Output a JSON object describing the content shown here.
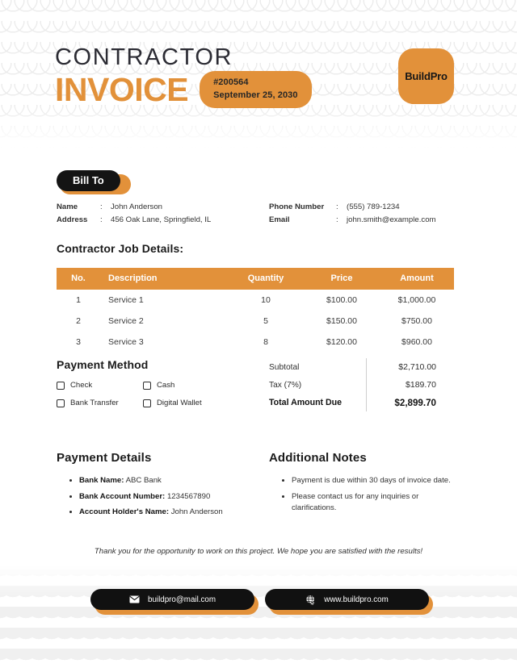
{
  "theme": {
    "accent": "#e2913a",
    "dark": "#141414",
    "text": "#2f2f2f",
    "pattern": "#ececec"
  },
  "header": {
    "title_top": "CONTRACTOR",
    "title_main": "INVOICE",
    "badge": {
      "number": "#200564",
      "date": "September 25, 2030"
    },
    "logo_text": "BuildPro"
  },
  "bill_to": {
    "badge_label": "Bill To",
    "left": [
      {
        "key": "Name",
        "sep": ":",
        "value": "John Anderson"
      },
      {
        "key": "Address",
        "sep": ":",
        "value": "456 Oak Lane, Springfield, IL"
      }
    ],
    "right": [
      {
        "key": "Phone Number",
        "sep": ":",
        "value": "(555) 789-1234"
      },
      {
        "key": "Email",
        "sep": ":",
        "value": "john.smith@example.com"
      }
    ]
  },
  "job_details": {
    "title": "Contractor Job Details:",
    "columns": [
      "No.",
      "Description",
      "Quantity",
      "Price",
      "Amount"
    ],
    "rows": [
      {
        "no": "1",
        "description": "Service 1",
        "quantity": "10",
        "price": "$100.00",
        "amount": "$1,000.00"
      },
      {
        "no": "2",
        "description": "Service 2",
        "quantity": "5",
        "price": "$150.00",
        "amount": "$750.00"
      },
      {
        "no": "3",
        "description": "Service 3",
        "quantity": "8",
        "price": "$120.00",
        "amount": "$960.00"
      }
    ]
  },
  "payment_method": {
    "title": "Payment Method",
    "options": [
      {
        "label": "Check",
        "checked": false
      },
      {
        "label": "Cash",
        "checked": false
      },
      {
        "label": "Bank Transfer",
        "checked": false
      },
      {
        "label": "Digital Wallet",
        "checked": false
      }
    ]
  },
  "totals": {
    "subtotal_label": "Subtotal",
    "subtotal_value": "$2,710.00",
    "tax_label": "Tax (7%)",
    "tax_value": "$189.70",
    "total_label": "Total Amount Due",
    "total_value": "$2,899.70"
  },
  "payment_details": {
    "title": "Payment Details",
    "items": [
      {
        "label": "Bank Name:",
        "value": "ABC Bank"
      },
      {
        "label": "Bank Account Number:",
        "value": "1234567890"
      },
      {
        "label": "Account Holder's Name:",
        "value": "John Anderson"
      }
    ]
  },
  "additional_notes": {
    "title": "Additional Notes",
    "items": [
      "Payment is due within 30 days of invoice date.",
      "Please contact us for any inquiries or clarifications."
    ]
  },
  "thanks": "Thank you for the opportunity to work on this project. We hope you are satisfied with the results!",
  "footer": {
    "email_icon": "envelope-icon",
    "email": "buildpro@mail.com",
    "web_icon": "globe-icon",
    "website": "www.buildpro.com"
  }
}
